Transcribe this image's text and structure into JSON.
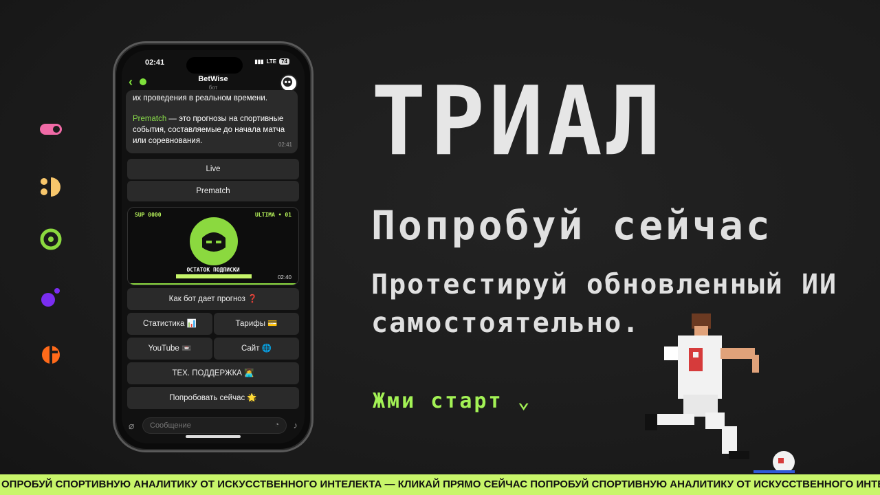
{
  "brand_colors": {
    "accent_green": "#a3f255",
    "ticker_bg": "#c8f56a"
  },
  "side_icons": [
    "toggle-icon",
    "half-circle-icon",
    "target-icon",
    "planet-icon",
    "orange-logo-icon"
  ],
  "phone": {
    "status_time": "02:41",
    "network": "LTE",
    "battery": "74",
    "chat_title": "BetWise",
    "chat_subtitle": "бот",
    "message_top": "их проведения в реальном времени.",
    "message_prematch_term": "Prematch",
    "message_prematch_text": " — это прогнозы на спортивные события, составляемые до начала матча или соревнования.",
    "message_time": "02:41",
    "buttons": {
      "live": "Live",
      "prematch": "Prematch",
      "how": "Как бот дает прогноз ❓",
      "stats": "Статистика 📊",
      "tariffs": "Тарифы 💳",
      "youtube": "YouTube 📼",
      "site": "Сайт 🌐",
      "support": "ТЕХ. ПОДДЕРЖКА 👩‍💻",
      "try": "Попробовать сейчас 🌟"
    },
    "media": {
      "top_left": "SUP 0000",
      "top_right": "ULTIMA • 01",
      "caption": "ОСТАТОК ПОДПИСКИ",
      "time": "02:40"
    },
    "compose_placeholder": "Сообщение"
  },
  "hero": {
    "title": "ТРИАЛ",
    "subtitle": "Попробуй сейчас",
    "body": "Протестируй обновленный ИИ самостоятельно.",
    "cta": "Жми старт ⌄"
  },
  "ticker": "ОПРОБУЙ СПОРТИВНУЮ АНАЛИТИКУ ОТ ИСКУССТВЕННОГО ИНТЕЛЕКТА — КЛИКАЙ ПРЯМО СЕЙЧАС ПОПРОБУЙ СПОРТИВНУЮ АНАЛИТИКУ ОТ ИСКУССТВЕННОГО ИНТЕЛЕКТА —"
}
